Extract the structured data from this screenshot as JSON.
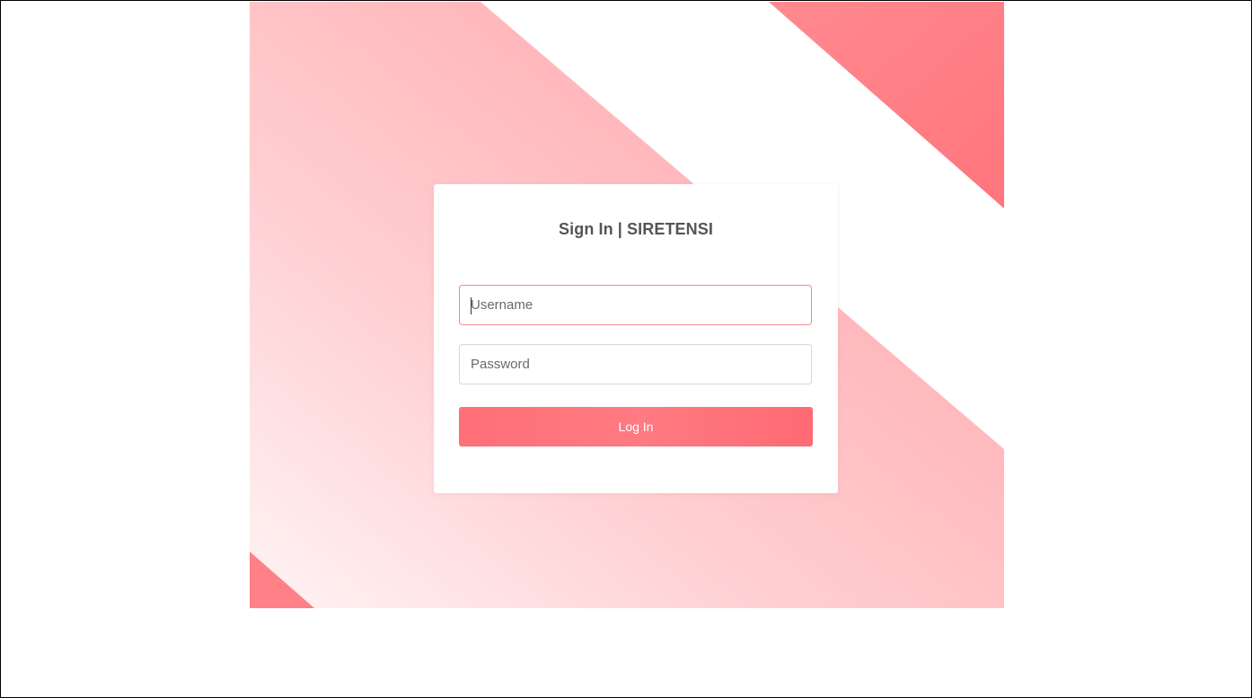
{
  "login": {
    "title": "Sign In | SIRETENSI",
    "username_placeholder": "Username",
    "password_placeholder": "Password",
    "button_label": "Log In"
  },
  "theme": {
    "accent": "#ff6f78",
    "light_pink": "#ffb5b9",
    "border": "#d6d6d6"
  }
}
